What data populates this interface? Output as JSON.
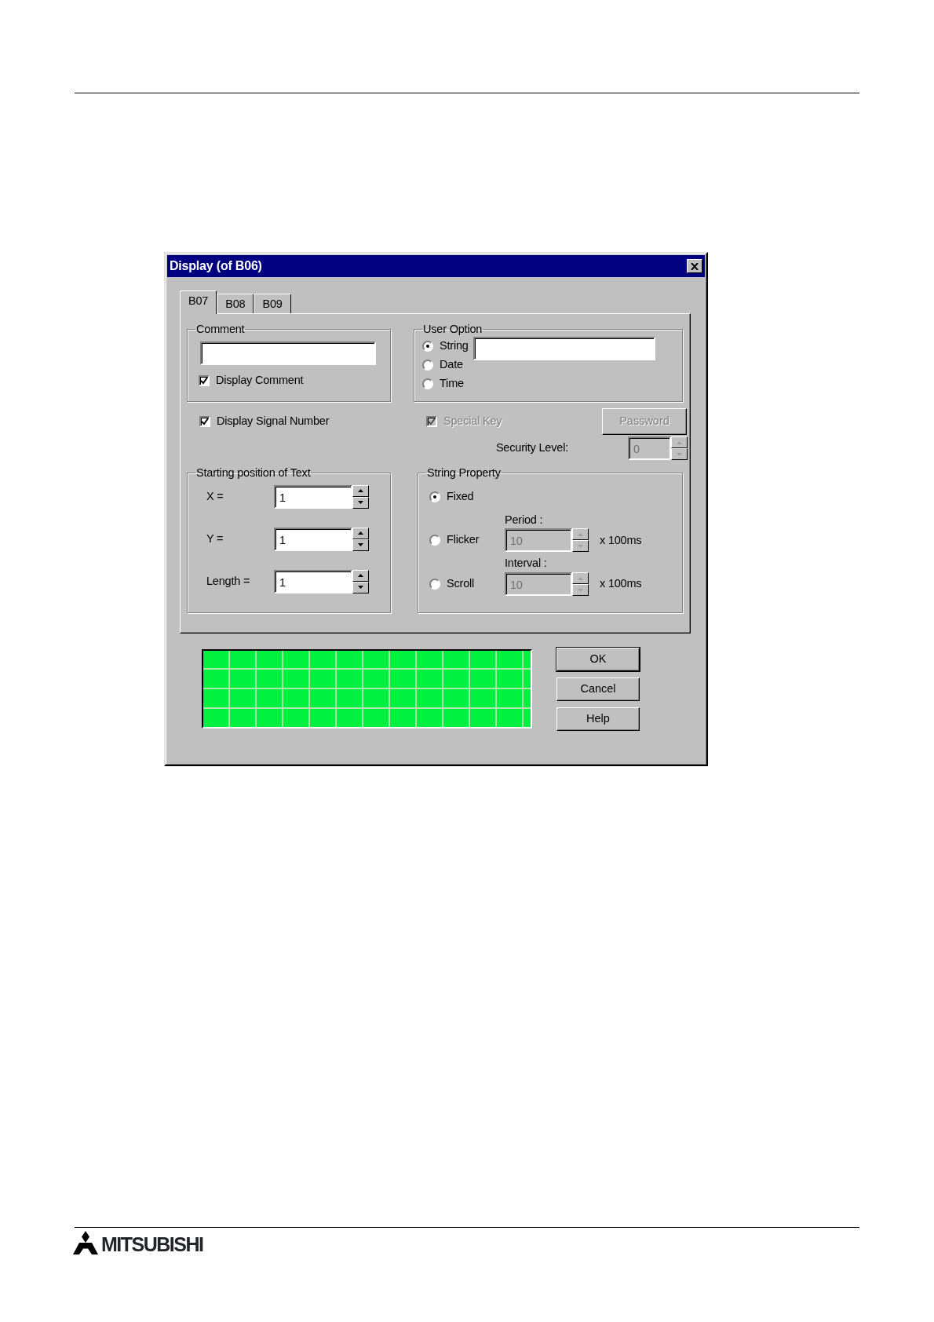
{
  "dialog": {
    "title": "Display (of B06)",
    "tabs": [
      {
        "label": "B07",
        "selected": true
      },
      {
        "label": "B08",
        "selected": false
      },
      {
        "label": "B09",
        "selected": false
      }
    ],
    "comment_group": {
      "title": "Comment",
      "checkbox": {
        "label": "Display Comment",
        "checked": true
      }
    },
    "user_option": {
      "title": "User Option",
      "options": [
        {
          "label": "String",
          "selected": true
        },
        {
          "label": "Date",
          "selected": false
        },
        {
          "label": "Time",
          "selected": false
        }
      ]
    },
    "display_signal_number": {
      "label": "Display Signal Number",
      "checked": true
    },
    "special_key": {
      "label": "Special Key",
      "checked": true,
      "disabled": true
    },
    "password_button": {
      "label": "Password",
      "disabled": true
    },
    "security_level": {
      "label": "Security Level:",
      "value": "0",
      "disabled": true
    },
    "starting_position": {
      "title": "Starting position of Text",
      "fields": [
        {
          "label": "X =",
          "value": "1"
        },
        {
          "label": "Y =",
          "value": "1"
        },
        {
          "label": "Length =",
          "value": "1"
        }
      ]
    },
    "string_property": {
      "title": "String Property",
      "options": [
        {
          "label": "Fixed",
          "selected": true
        },
        {
          "label": "Flicker",
          "selected": false,
          "field_label": "Period :",
          "value": "10",
          "unit": "x 100ms",
          "disabled": true
        },
        {
          "label": "Scroll",
          "selected": false,
          "field_label": "Interval :",
          "value": "10",
          "unit": "x 100ms",
          "disabled": true
        }
      ]
    },
    "buttons": [
      {
        "label": "OK",
        "default": true
      },
      {
        "label": "Cancel",
        "default": false
      },
      {
        "label": "Help",
        "default": false
      }
    ]
  },
  "footer": {
    "logo_text": "MITSUBISHI"
  }
}
